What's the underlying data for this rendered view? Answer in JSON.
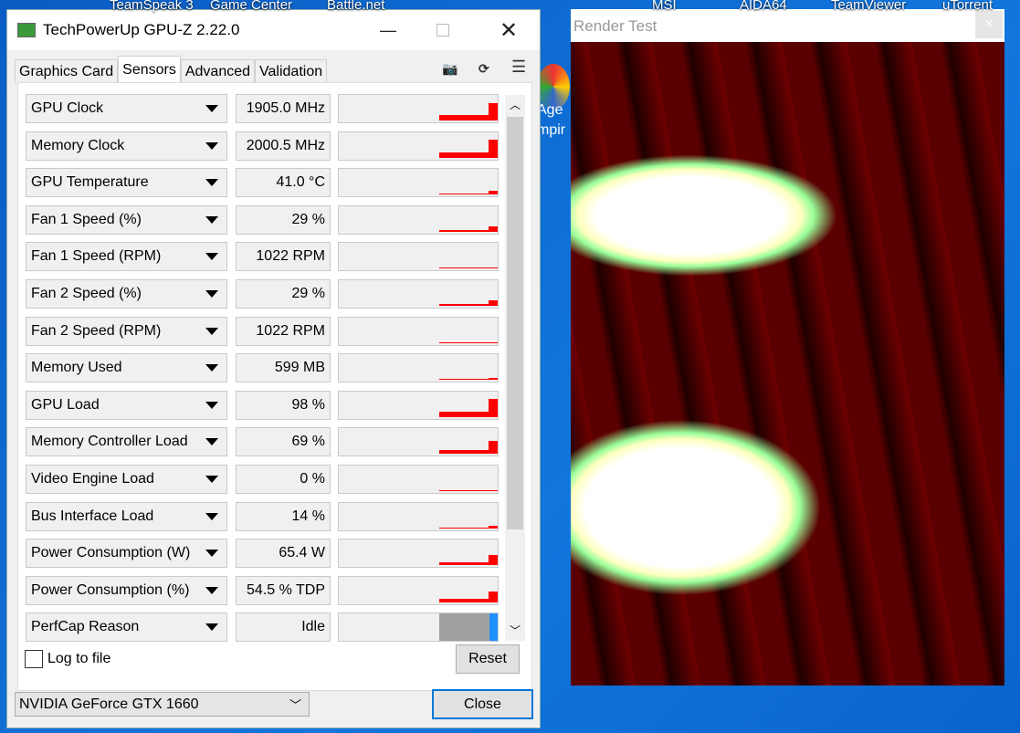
{
  "desktop": {
    "labels": [
      "TeamSpeak 3",
      "Game Center",
      "Battle.net",
      "MSI",
      "AIDA64",
      "TeamViewer",
      "uTorrent"
    ],
    "icon_label": "Age\nmpir"
  },
  "window": {
    "title": "TechPowerUp GPU-Z 2.22.0"
  },
  "tabs": [
    "Graphics Card",
    "Sensors",
    "Advanced",
    "Validation"
  ],
  "active_tab": "Sensors",
  "toolbar_icons": [
    "camera-icon",
    "refresh-icon",
    "menu-icon"
  ],
  "sensors": [
    {
      "name": "GPU Clock",
      "value": "1905.0 MHz",
      "level": 0.85
    },
    {
      "name": "Memory Clock",
      "value": "2000.5 MHz",
      "level": 0.9
    },
    {
      "name": "GPU Temperature",
      "value": "41.0 °C",
      "level": 0.2
    },
    {
      "name": "Fan 1 Speed (%)",
      "value": "29 %",
      "level": 0.29
    },
    {
      "name": "Fan 1 Speed (RPM)",
      "value": "1022 RPM",
      "level": 0.05
    },
    {
      "name": "Fan 2 Speed (%)",
      "value": "29 %",
      "level": 0.29
    },
    {
      "name": "Fan 2 Speed (RPM)",
      "value": "1022 RPM",
      "level": 0.05
    },
    {
      "name": "Memory Used",
      "value": "599 MB",
      "level": 0.1
    },
    {
      "name": "GPU Load",
      "value": "98 %",
      "level": 0.9
    },
    {
      "name": "Memory Controller Load",
      "value": "69 %",
      "level": 0.65
    },
    {
      "name": "Video Engine Load",
      "value": "0 %",
      "level": 0
    },
    {
      "name": "Bus Interface Load",
      "value": "14 %",
      "level": 0.12
    },
    {
      "name": "Power Consumption (W)",
      "value": "65.4 W",
      "level": 0.5
    },
    {
      "name": "Power Consumption (%)",
      "value": "54.5 % TDP",
      "level": 0.55
    },
    {
      "name": "PerfCap Reason",
      "value": "Idle",
      "level": 1
    }
  ],
  "colors": {
    "graph": "#ff0000",
    "perfcap_idle": "#a0a0a0",
    "perfcap_other": "#1e90ff"
  },
  "log_label": "Log to file",
  "reset_label": "Reset",
  "gpu_select": "NVIDIA GeForce GTX 1660",
  "close_label": "Close",
  "render": {
    "title": "Render Test",
    "close": "×"
  }
}
